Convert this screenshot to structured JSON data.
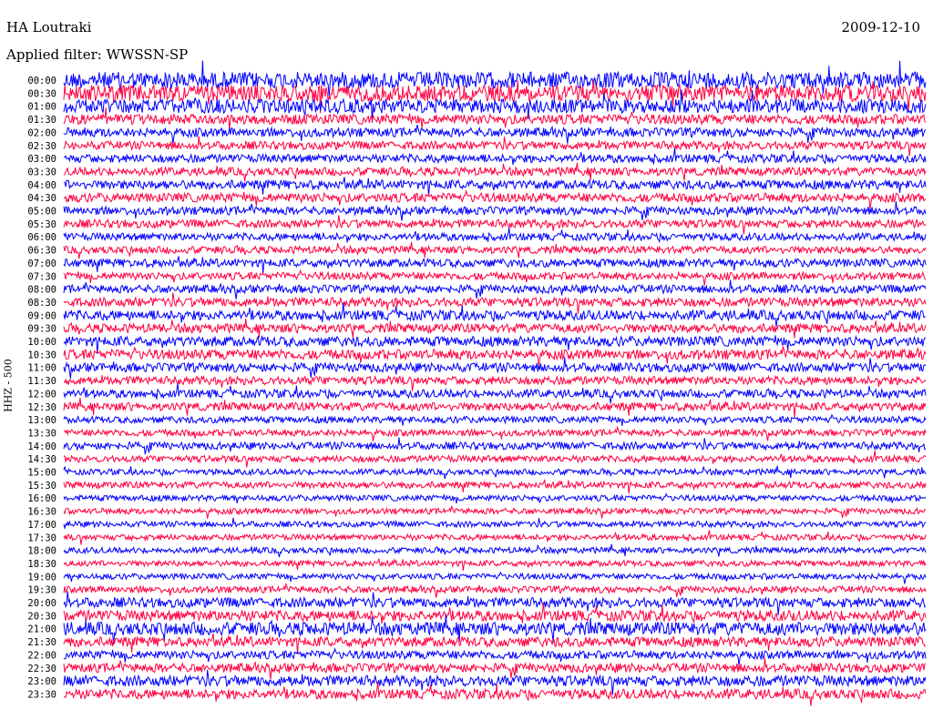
{
  "header": {
    "station": "HA Loutraki",
    "date": "2009-12-10",
    "filter_text": "Applied filter: WWSSN-SP"
  },
  "chart_data": {
    "type": "line",
    "title": "HA Loutraki",
    "subtitle": "Applied filter: WWSSN-SP",
    "ylabel": "HHZ - 500",
    "date": "2009-12-10",
    "row_labels": [
      "00:00",
      "00:30",
      "01:00",
      "01:30",
      "02:00",
      "02:30",
      "03:00",
      "03:30",
      "04:00",
      "04:30",
      "05:00",
      "05:30",
      "06:00",
      "06:30",
      "07:00",
      "07:30",
      "08:00",
      "08:30",
      "09:00",
      "09:30",
      "10:00",
      "10:30",
      "11:00",
      "11:30",
      "12:00",
      "12:30",
      "13:00",
      "13:30",
      "14:00",
      "14:30",
      "15:00",
      "15:30",
      "16:00",
      "16:30",
      "17:00",
      "17:30",
      "18:00",
      "18:30",
      "19:00",
      "19:30",
      "20:00",
      "20:30",
      "21:00",
      "21:30",
      "22:00",
      "22:30",
      "23:00",
      "23:30"
    ],
    "trace_colors": [
      "#0000ff",
      "#ff0040"
    ],
    "amplitude_level": [
      1.0,
      1.0,
      0.85,
      0.6,
      0.55,
      0.5,
      0.5,
      0.5,
      0.55,
      0.55,
      0.5,
      0.5,
      0.45,
      0.45,
      0.5,
      0.45,
      0.5,
      0.55,
      0.6,
      0.55,
      0.6,
      0.6,
      0.55,
      0.5,
      0.5,
      0.5,
      0.4,
      0.4,
      0.45,
      0.4,
      0.35,
      0.4,
      0.35,
      0.35,
      0.35,
      0.35,
      0.35,
      0.35,
      0.35,
      0.4,
      0.6,
      0.65,
      0.8,
      0.6,
      0.5,
      0.55,
      0.65,
      0.6
    ],
    "grid": false
  }
}
